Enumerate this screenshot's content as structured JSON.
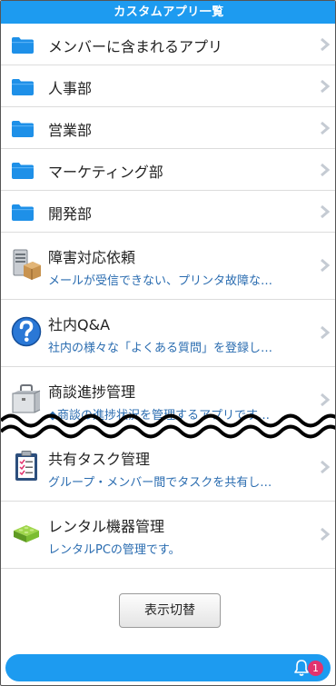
{
  "header": {
    "title": "カスタムアプリ一覧"
  },
  "folders": [
    {
      "label": "メンバーに含まれるアプリ"
    },
    {
      "label": "人事部"
    },
    {
      "label": "営業部"
    },
    {
      "label": "マーケティング部"
    },
    {
      "label": "開発部"
    }
  ],
  "apps": [
    {
      "title": "障害対応依頼",
      "desc": "メールが受信できない、プリンタ故障な…",
      "icon": "server-box-icon"
    },
    {
      "title": "社内Q&A",
      "desc": "社内の様々な「よくある質問」を登録し…",
      "icon": "question-icon"
    },
    {
      "title": "商談進捗管理",
      "desc": "◆商談の進捗状況を管理するアプリです…",
      "icon": "briefcase-icon"
    },
    {
      "title": "共有タスク管理",
      "desc": "グループ・メンバー間でタスクを共有し…",
      "icon": "clipboard-icon"
    },
    {
      "title": "レンタル機器管理",
      "desc": "レンタルPCの管理です。",
      "icon": "green-block-icon"
    }
  ],
  "toggle_button": {
    "label": "表示切替"
  },
  "notifications": {
    "count": "1"
  },
  "colors": {
    "accent": "#1d9bf0",
    "desc_text": "#2a6cb0",
    "badge": "#e2336e",
    "folder": "#1e90e8"
  }
}
